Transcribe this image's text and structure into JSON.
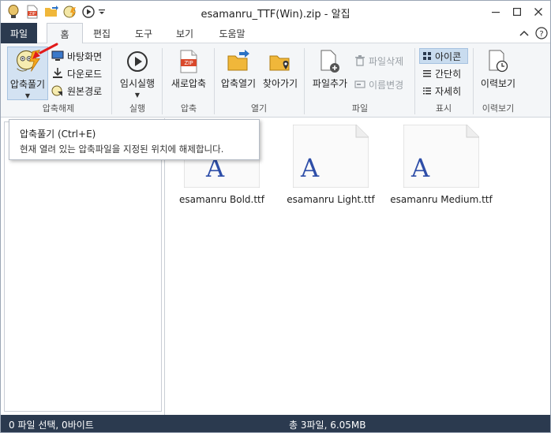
{
  "window": {
    "title": "esamanru_TTF(Win).zip - 알집"
  },
  "quick_access": {
    "icons": [
      "app-logo-icon",
      "zip-icon",
      "folder-open-icon",
      "extract-icon",
      "play-icon",
      "dropdown-icon"
    ]
  },
  "tabs": {
    "file": "파일",
    "home": "홈",
    "edit": "편집",
    "tools": "도구",
    "view": "보기",
    "help": "도움말"
  },
  "ribbon": {
    "extract": {
      "big_label": "압축풀기",
      "desktop": "바탕화면",
      "downloads": "다운로드",
      "original_path": "원본경로",
      "group": "압축해제"
    },
    "run": {
      "label": "임시실행",
      "group": "실행"
    },
    "compress": {
      "label": "새로압축",
      "group": "압축"
    },
    "open": {
      "open_compressed": "압축열기",
      "find": "찾아가기",
      "group": "열기"
    },
    "file": {
      "add": "파일추가",
      "delete": "파일삭제",
      "rename": "이름변경",
      "group": "파일"
    },
    "display": {
      "icon": "아이콘",
      "simple": "간단히",
      "detail": "자세히",
      "group": "표시"
    },
    "history": {
      "label": "이력보기",
      "group": "이력보기"
    }
  },
  "tooltip": {
    "title": "압축풀기 (Ctrl+E)",
    "description": "현재 열려 있는 압축파일을 지정된 위치에 해제합니다."
  },
  "files": [
    {
      "name": "esamanru Bold.ttf"
    },
    {
      "name": "esamanru Light.ttf"
    },
    {
      "name": "esamanru Medium.ttf"
    }
  ],
  "status": {
    "selection": "0 파일 선택,  0바이트",
    "total": "총 3파일,  6.05MB"
  },
  "colors": {
    "dark_bar": "#2b3a4f",
    "ribbon_bg": "#f4f6f8",
    "selected_bg": "#d3e2f2",
    "font_glyph": "#2e4ea8"
  }
}
